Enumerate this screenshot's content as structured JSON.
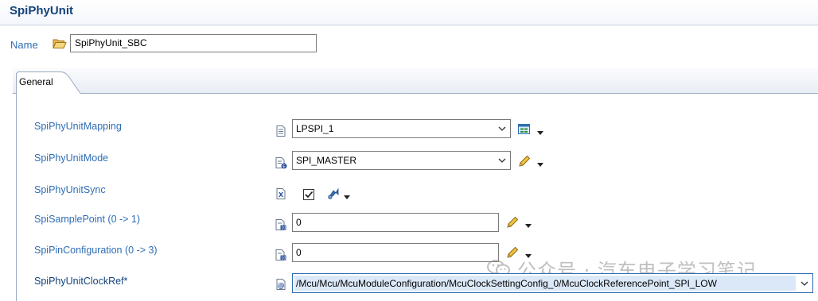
{
  "header": {
    "title": "SpiPhyUnit"
  },
  "name_field": {
    "label": "Name",
    "value": "SpiPhyUnit_SBC",
    "icon": "folder-open-icon"
  },
  "tabs": [
    {
      "label": "General",
      "selected": true
    }
  ],
  "fields": {
    "mapping": {
      "label": "SpiPhyUnitMapping",
      "value": "LPSPI_1",
      "type_icon": "document-icon",
      "action_icon": "form-editor-icon"
    },
    "mode": {
      "label": "SpiPhyUnitMode",
      "value": "SPI_MASTER",
      "type_icon": "enum-icon",
      "action_icon": "pencil-icon"
    },
    "sync": {
      "label": "SpiPhyUnitSync",
      "checked": true,
      "type_icon": "boolean-icon",
      "action_icon": "link-arrow-icon"
    },
    "sample_point": {
      "label": "SpiSamplePoint (0 -> 1)",
      "value": "0",
      "type_icon": "integer-icon",
      "action_icon": "pencil-icon"
    },
    "pin_config": {
      "label": "SpiPinConfiguration (0 -> 3)",
      "value": "0",
      "type_icon": "integer-icon",
      "action_icon": "pencil-icon"
    },
    "clock_ref": {
      "label": "SpiPhyUnitClockRef*",
      "value": "/Mcu/Mcu/McuModuleConfiguration/McuClockSettingConfig_0/McuClockReferencePoint_SPI_LOW",
      "type_icon": "reference-at-icon"
    }
  },
  "watermark": {
    "text": "公众号 · 汽车电子学习笔记"
  },
  "colors": {
    "label_blue": "#2e6db5",
    "title_blue": "#14427a",
    "border": "#7a7a7a"
  }
}
